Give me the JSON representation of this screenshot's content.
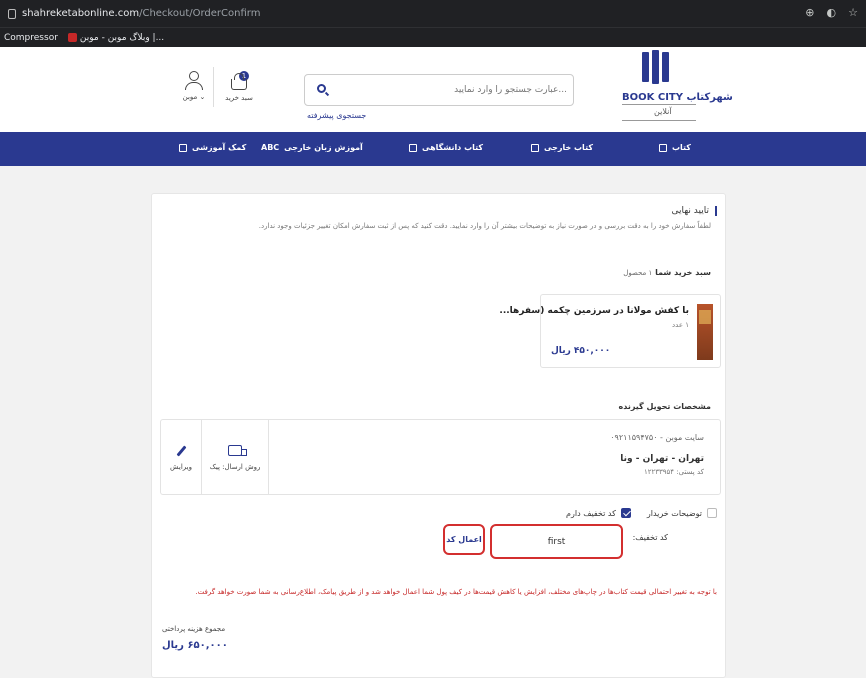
{
  "browser": {
    "url_host": "shahreketabonline.com",
    "url_path": "/Checkout/OrderConfirm",
    "bookmarks": [
      "Compressor",
      "وبلاگ موبن - موبن |..."
    ]
  },
  "header": {
    "logo_title": "BOOK CITY شهرکتاب",
    "logo_sub": "آنلاین",
    "search_placeholder": "عبارت جستجو را وارد نمایید...",
    "advanced_search": "جستجوی پیشرفته",
    "cart_label": "سبد خرید",
    "cart_count": "1",
    "user_label": "موبن"
  },
  "nav": {
    "items": [
      {
        "label": "کتاب",
        "icon": "book-icon"
      },
      {
        "label": "کتاب خارجی",
        "icon": "foreign-book-icon"
      },
      {
        "label": "کتاب دانشگاهی",
        "icon": "university-icon"
      },
      {
        "label": "آموزش زبان خارجی",
        "icon": "abc-icon"
      },
      {
        "label": "کمک آموزشی",
        "icon": "education-icon"
      }
    ],
    "abc_text": "ABC"
  },
  "order": {
    "title": "تایید نهایی",
    "description": "لطفاً سفارش خود را به دقت بررسی و در صورت نیاز به توضیحات بیشتر آن را وارد نمایید. دقت کنید که پس از ثبت سفارش امکان تغییر جزئیات وجود ندارد.",
    "cart_title": "سبد خرید شما",
    "cart_count": "۱ محصول",
    "product": {
      "name": "با کفش مولانا در سرزمین چکمه (سفرها...",
      "qty": "۱ عدد",
      "price": "۴۵۰,۰۰۰ ریال"
    },
    "receiver_title": "مشخصات تحویل گیرنده",
    "receiver": {
      "phone": "سایت موبن - ۰۹۲۱۱۵۹۴۷۵۰",
      "address": "تهران - تهران - ونا",
      "postal": "کد پستی: ۱۲۲۳۳۹۵۴"
    },
    "shipping_label": "روش ارسال: پیک",
    "edit_label": "ویرایش",
    "buyer_notes": "توضیحات خریدار",
    "has_discount": "کد تخفیف دارم",
    "discount_label": "کد تخفیف:",
    "discount_value": "first",
    "apply_label": "اعمال کد",
    "warning": "با توجه به تغییر احتمالی قیمت کتاب‌ها در چاپ‌های مختلف، افزایش یا کاهش قیمت‌ها در کیف پول شما اعمال خواهد شد و از طریق پیامک، اطلاع‌رسانی به شما صورت خواهد گرفت.",
    "total_label": "مجموع هزینه پرداختی",
    "total_value": "۶۵۰,۰۰۰ ریال"
  },
  "colors": {
    "brand": "#2a3990",
    "highlight": "#d32f2f"
  }
}
